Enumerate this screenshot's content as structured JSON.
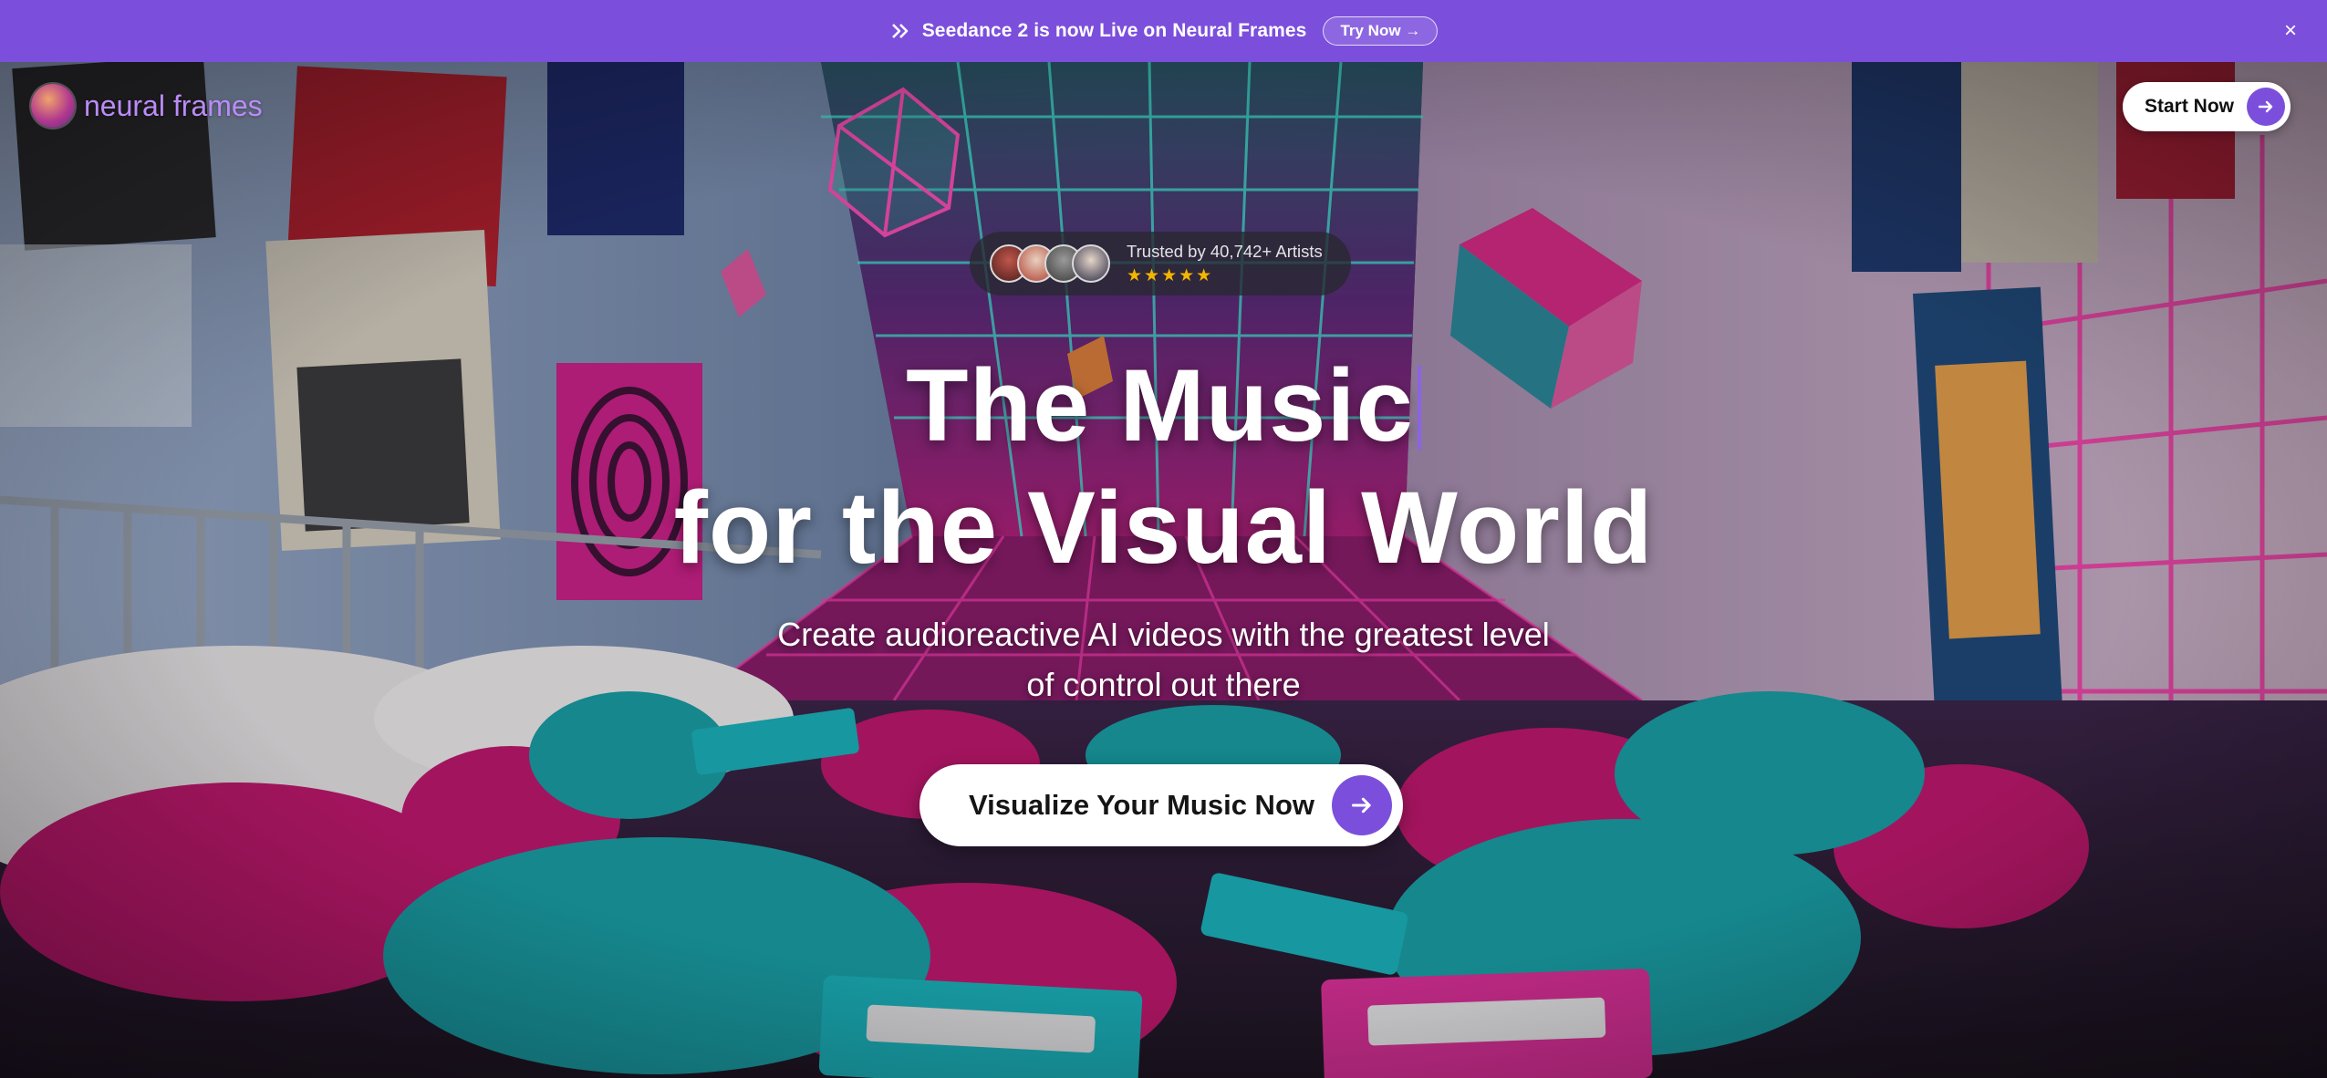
{
  "announcement": {
    "icon": "double-chevron-icon",
    "message": "Seedance 2 is now Live on Neural Frames",
    "cta_label": "Try Now →",
    "close_label": "×"
  },
  "header": {
    "logo_text": "neural frames",
    "start_button_label": "Start Now"
  },
  "trust": {
    "text": "Trusted by 40,742+ Artists",
    "stars": "★★★★★",
    "rating": 5
  },
  "hero": {
    "title_line1": "The Music",
    "title_line2": "for the Visual World",
    "subtitle_line1": "Create audioreactive AI videos with the greatest level",
    "subtitle_line2": "of control out there",
    "cta_label": "Visualize Your Music Now"
  },
  "colors": {
    "brand_purple": "#7b4fdc",
    "logo_text": "#b98cf5",
    "star": "#f5b400"
  }
}
